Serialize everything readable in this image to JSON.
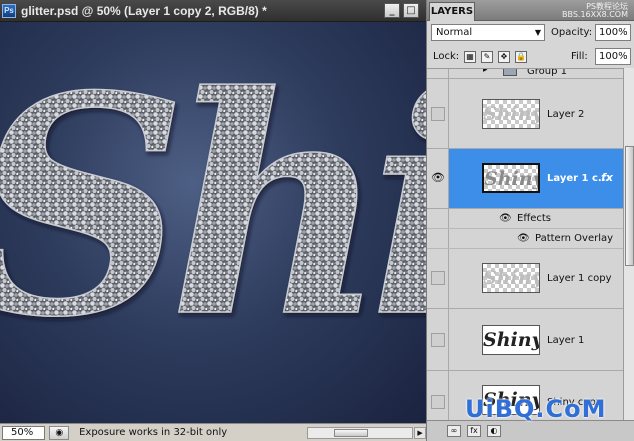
{
  "document": {
    "title": "glitter.psd @ 50% (Layer 1 copy 2, RGB/8) *",
    "canvas_text": "Shiny",
    "window_buttons": {
      "minimize": "_",
      "maximize": "□"
    }
  },
  "status_bar": {
    "zoom": "50%",
    "message": "Exposure works in 32-bit only"
  },
  "layers_panel": {
    "tab_label": "LAYERS",
    "watermark_top": [
      "PS教程论坛",
      "BBS.16XX8.COM"
    ],
    "blend_mode": "Normal",
    "opacity_label": "Opacity:",
    "opacity_value": "100%",
    "lock_label": "Lock:",
    "fill_label": "Fill:",
    "fill_value": "100%",
    "layers": [
      {
        "name": "Group 1",
        "type": "group",
        "visible": false
      },
      {
        "name": "Layer 2",
        "thumb_text": "Shiny",
        "visible": false
      },
      {
        "name": "Layer 1 c...",
        "thumb_text": "Shiny",
        "visible": true,
        "selected": true,
        "fx": "fx"
      },
      {
        "name": "Effects",
        "type": "effects-header"
      },
      {
        "name": "Pattern Overlay",
        "type": "effect"
      },
      {
        "name": "Layer 1 copy",
        "thumb_text": "Shiny",
        "visible": false
      },
      {
        "name": "Layer 1",
        "thumb_text": "Shiny",
        "visible": false
      },
      {
        "name": "Shiny copy",
        "thumb_text": "Shiny",
        "visible": false
      }
    ],
    "watermark_bottom": "UiBQ.CoM"
  },
  "colors": {
    "selection": "#3d8ee8",
    "canvas_center": "#4e5f85",
    "canvas_edge": "#1a2340",
    "watermark": "#2f6fd6"
  }
}
